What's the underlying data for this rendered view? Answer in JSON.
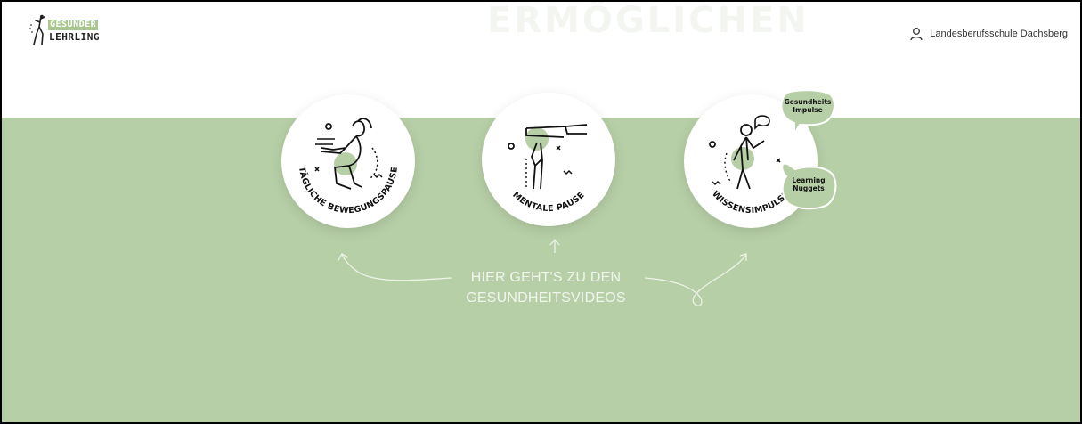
{
  "header": {
    "logo": {
      "word_top": "GESUNDER",
      "word_bottom": "LEHRLING"
    },
    "ghost_heading": "ERMÖGLICHEN",
    "account": {
      "label": "Landesberufsschule Dachsberg",
      "icon": "user-icon"
    }
  },
  "cards": [
    {
      "label": "TÄGLICHE BEWEGUNGSPAUSE",
      "icon": "squat-exercise-icon"
    },
    {
      "label": "MENTALE PAUSE",
      "icon": "hand-pause-icon"
    },
    {
      "label": "WISSENSIMPULSE",
      "icon": "knowledge-person-icon"
    }
  ],
  "bubbles": [
    {
      "line1": "Gesundheits",
      "line2": "Impulse"
    },
    {
      "line1": "Learning",
      "line2": "Nuggets"
    }
  ],
  "cta": {
    "line1": "HIER GEHT'S ZU DEN",
    "line2": "GESUNDHEITSVIDEOS"
  },
  "colors": {
    "accent_green": "#b7cfa7",
    "logo_green": "#a9c68f",
    "cta_text": "#f2f5ee"
  }
}
